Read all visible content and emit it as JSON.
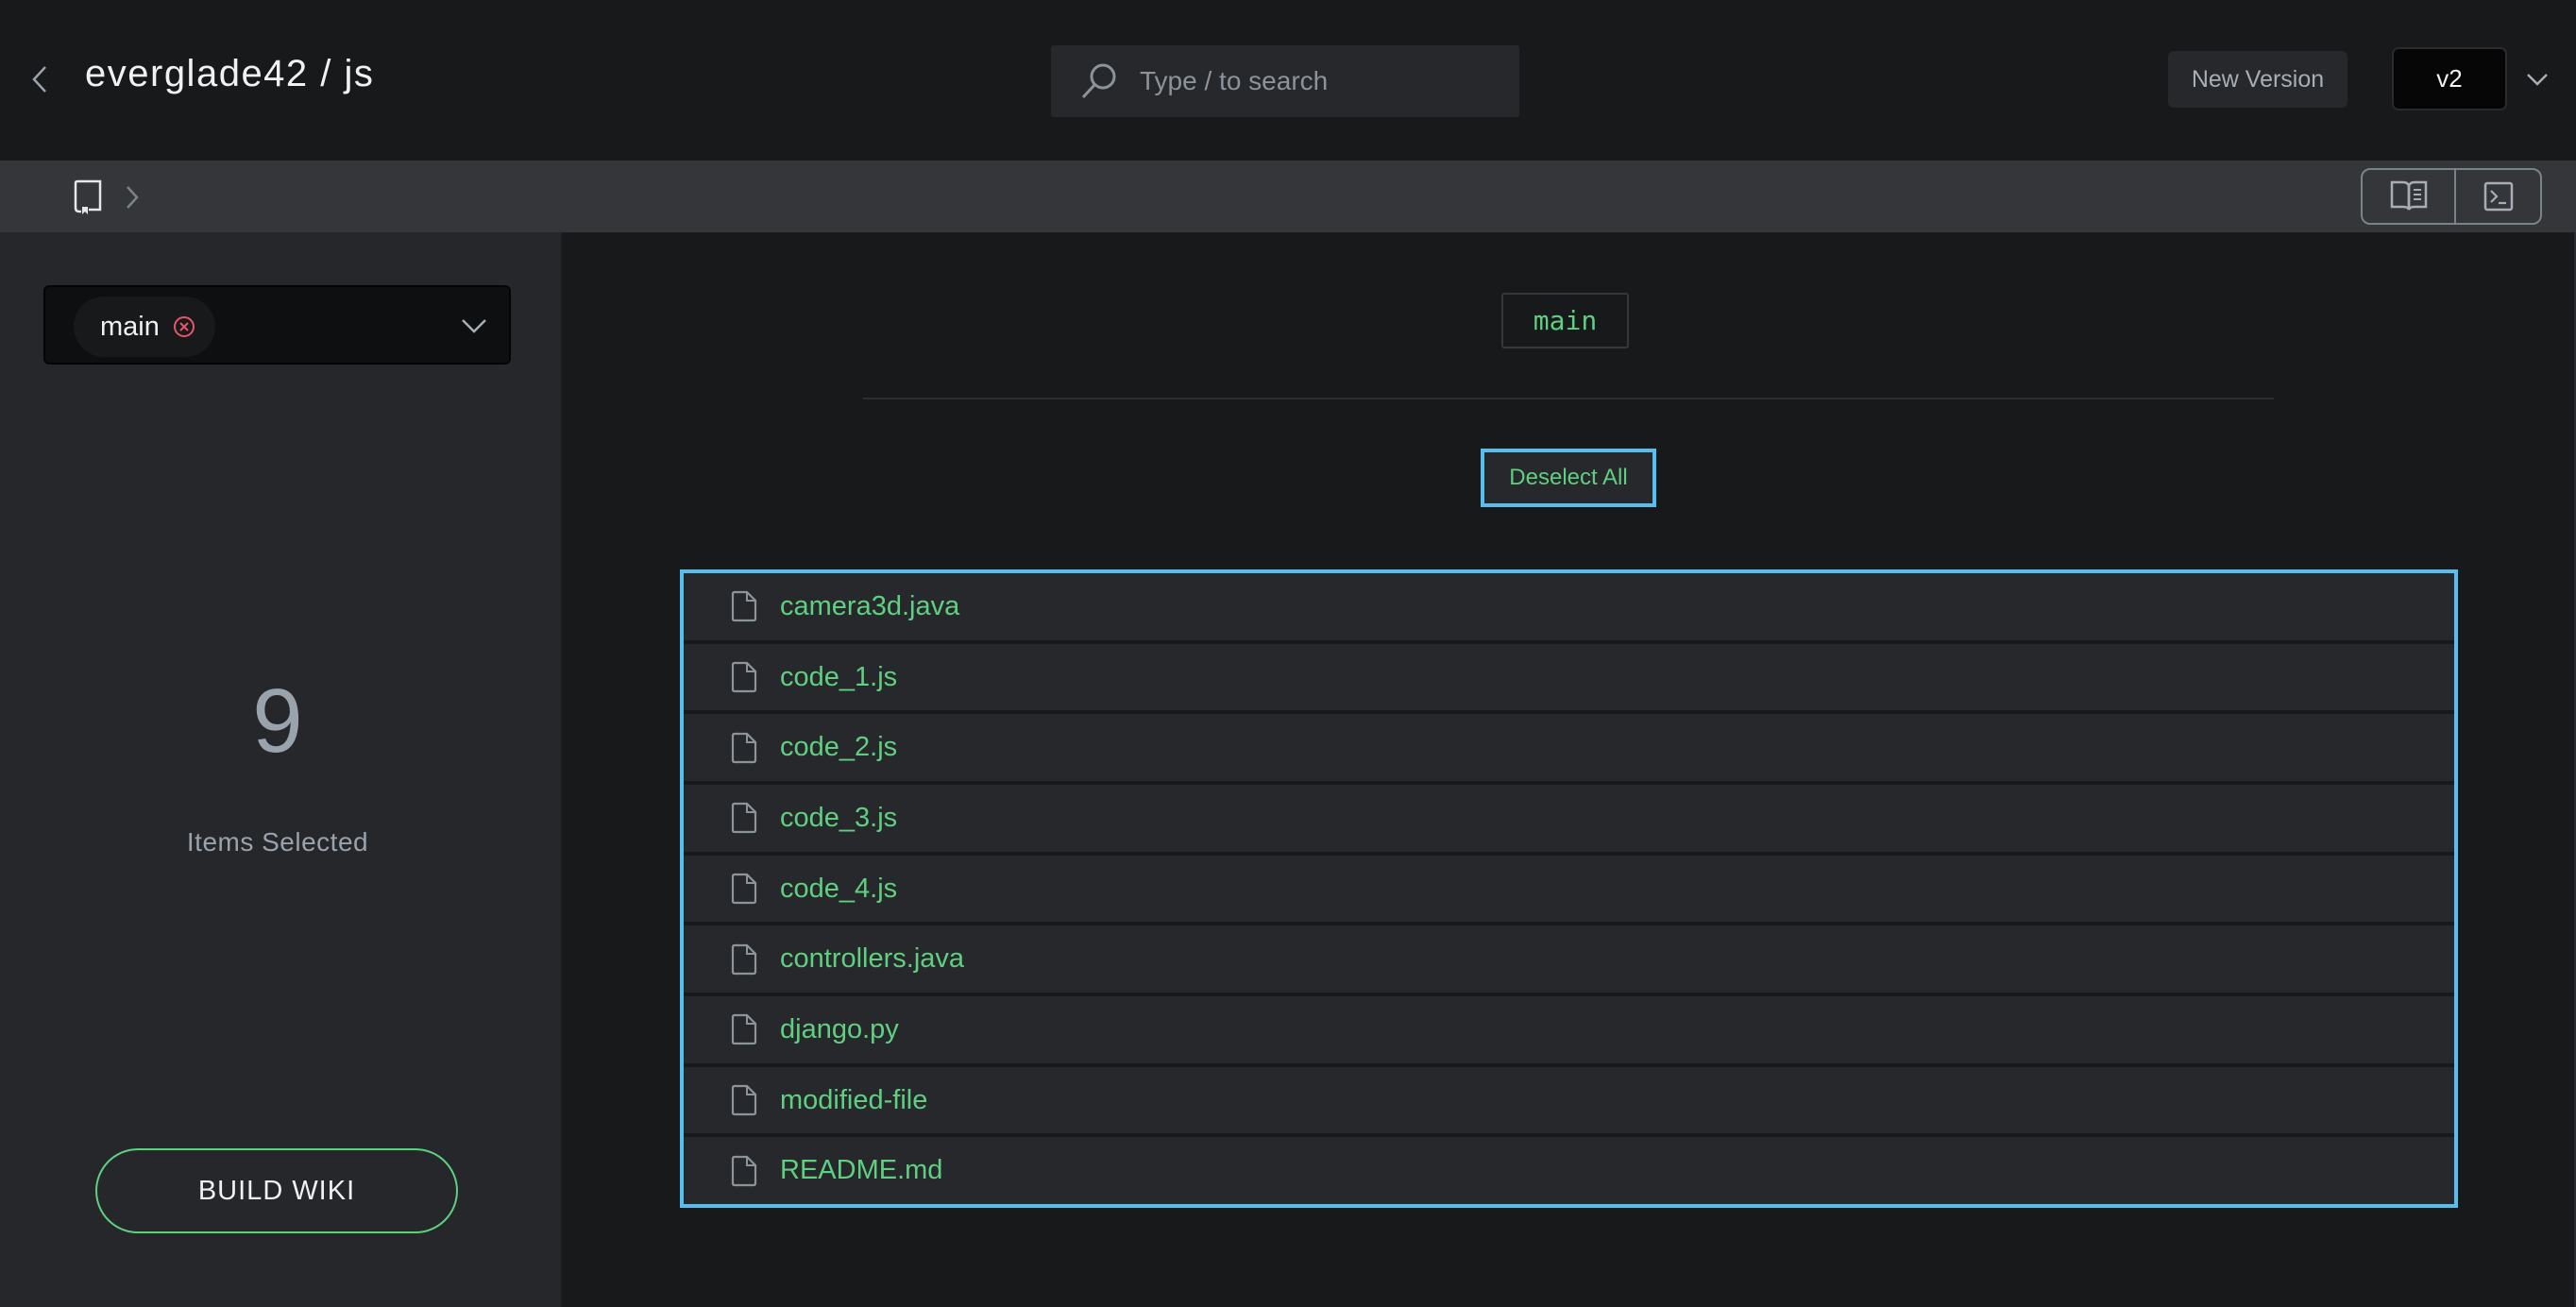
{
  "header": {
    "back_icon": "chevron-left-icon",
    "title": "everglade42 / js",
    "search": {
      "icon": "search-icon",
      "placeholder": "Type / to search",
      "value": ""
    },
    "new_version_label": "New Version",
    "version_selected": "v2",
    "version_dropdown_icon": "chevron-down-icon"
  },
  "breadcrumb": {
    "root_icon": "book-icon",
    "separator_icon": "chevron-right-icon",
    "view_toggle": [
      {
        "name": "docs-view",
        "icon": "open-book-icon"
      },
      {
        "name": "terminal-view",
        "icon": "terminal-icon"
      }
    ]
  },
  "sidebar": {
    "branch_select": {
      "selected_chip": "main",
      "remove_icon": "close-circle-icon",
      "dropdown_icon": "chevron-down-icon"
    },
    "selected_count": "9",
    "selected_label": "Items Selected",
    "build_button_label": "BUILD WIKI"
  },
  "main": {
    "branch_tag": "main",
    "deselect_all_label": "Deselect All",
    "files": [
      {
        "name": "camera3d.java",
        "icon": "file-icon"
      },
      {
        "name": "code_1.js",
        "icon": "file-icon"
      },
      {
        "name": "code_2.js",
        "icon": "file-icon"
      },
      {
        "name": "code_3.js",
        "icon": "file-icon"
      },
      {
        "name": "code_4.js",
        "icon": "file-icon"
      },
      {
        "name": "controllers.java",
        "icon": "file-icon"
      },
      {
        "name": "django.py",
        "icon": "file-icon"
      },
      {
        "name": "modified-file",
        "icon": "file-icon"
      },
      {
        "name": "README.md",
        "icon": "file-icon"
      }
    ]
  },
  "colors": {
    "accent_green": "#5fcf80",
    "selection_blue": "#56bff0",
    "remove_red": "#e5566b",
    "muted_text": "#9aa3ac"
  }
}
